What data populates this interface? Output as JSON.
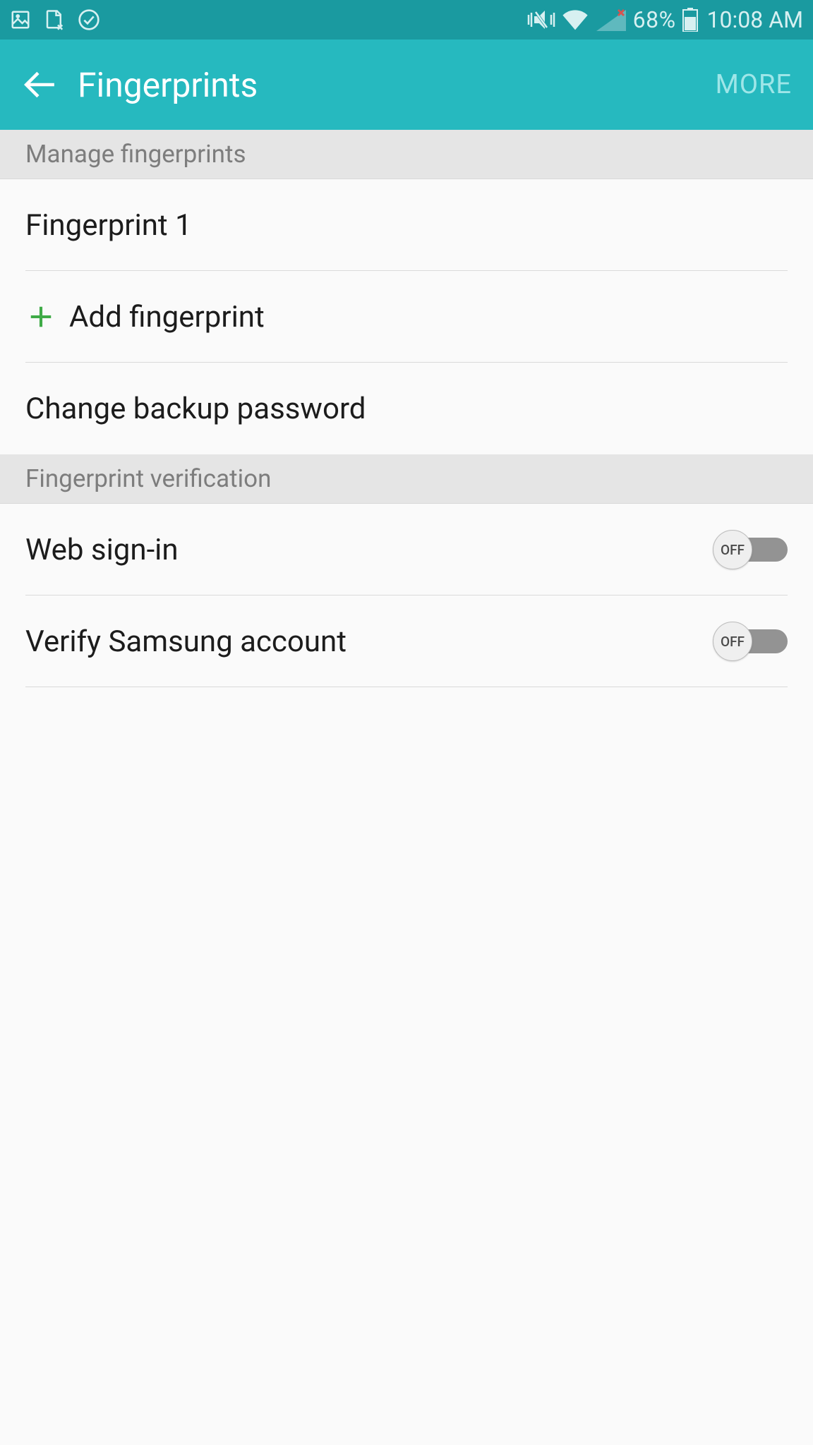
{
  "statusBar": {
    "batteryPct": "68%",
    "time": "10:08 AM"
  },
  "header": {
    "title": "Fingerprints",
    "more": "MORE"
  },
  "sections": {
    "manage": {
      "title": "Manage fingerprints",
      "items": {
        "fingerprint1": "Fingerprint 1",
        "add": "Add fingerprint",
        "changeBackup": "Change backup password"
      }
    },
    "verification": {
      "title": "Fingerprint verification",
      "items": {
        "webSignIn": {
          "label": "Web sign-in",
          "state": "OFF"
        },
        "verifySamsung": {
          "label": "Verify Samsung account",
          "state": "OFF"
        }
      }
    }
  }
}
